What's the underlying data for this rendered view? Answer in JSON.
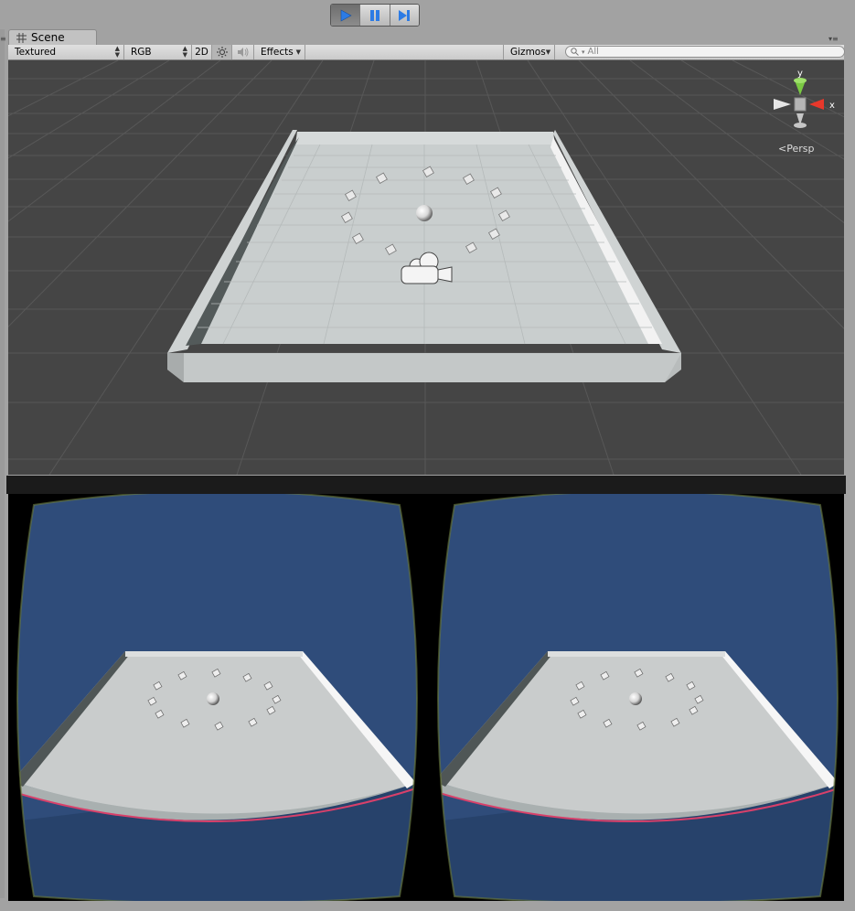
{
  "playbar": {
    "buttons": [
      {
        "name": "play",
        "icon": "play-icon",
        "active": true
      },
      {
        "name": "pause",
        "icon": "pause-icon",
        "active": false
      },
      {
        "name": "step",
        "icon": "step-icon",
        "active": false
      }
    ]
  },
  "tab": {
    "label": "Scene",
    "icon": "scene-grid-icon"
  },
  "toolbar": {
    "render_mode": "Textured",
    "color_mode": "RGB",
    "toggle_2d": "2D",
    "lighting_icon": "sun-icon",
    "audio_icon": "speaker-icon",
    "effects_label": "Effects",
    "gizmos_label": "Gizmos",
    "search_placeholder": "All"
  },
  "scene_view": {
    "orientation_gizmo": {
      "y_label": "y",
      "x_label": "x",
      "projection_label": "Persp"
    },
    "camera_icon": "camera-icon"
  },
  "colors": {
    "scene_background": "#454545",
    "grid_line": "#5a5a5a",
    "platform": "#c6cbcb",
    "sky_blue": "#2f4c7a",
    "y_axis": "#7ac943",
    "x_axis": "#e8382b"
  }
}
